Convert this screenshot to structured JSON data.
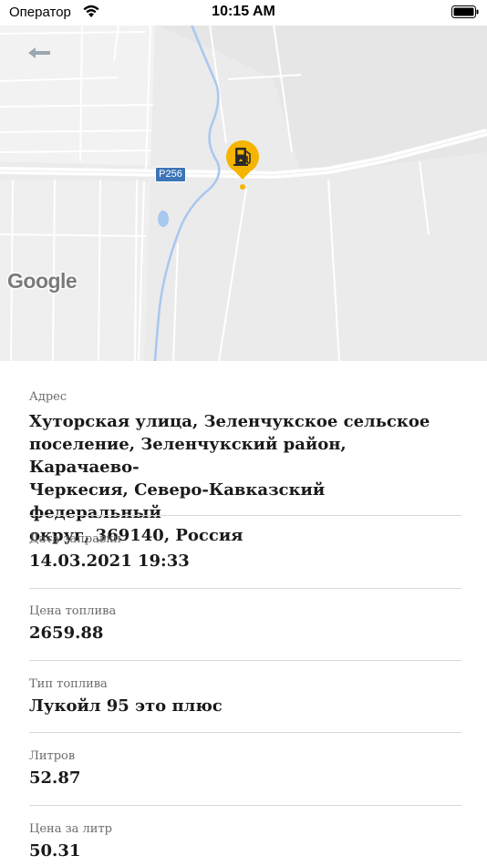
{
  "status_bar": {
    "carrier": "Оператор",
    "time": "10:15 AM",
    "icons": [
      "wifi-icon",
      "battery-icon"
    ]
  },
  "map": {
    "road_label": "P256",
    "provider_logo": "Google",
    "marker_icon": "fuel-station-icon",
    "marker_color": "#f5b400",
    "road_shield_color": "#3d75b8"
  },
  "details": {
    "address": {
      "label": "Адрес",
      "lines": [
        "Хуторская улица, Зеленчукское сельское",
        "поселение, Зеленчукский район, Карачаево-",
        "Черкесия, Северо-Кавказский федеральный",
        "округ, 369140, Россия"
      ]
    },
    "refuel_date": {
      "label": "Дата заправки",
      "value": "14.03.2021 19:33"
    },
    "fuel_price": {
      "label": "Цена топлива",
      "value": "2659.88"
    },
    "fuel_type": {
      "label": "Тип топлива",
      "value": "Лукойл 95 это плюс"
    },
    "liters": {
      "label": "Литров",
      "value": "52.87"
    },
    "price_per_liter": {
      "label": "Цена за литр",
      "value": "50.31"
    }
  }
}
